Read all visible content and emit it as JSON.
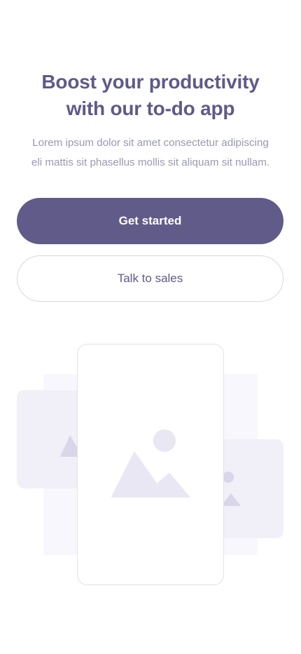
{
  "hero": {
    "title_lines": [
      "Boost your productivity",
      "with our to-do app"
    ],
    "subtitle_lines": [
      "Lorem ipsum dolor sit amet consectetur adipiscing",
      "eli mattis sit phasellus mollis sit aliquam sit nullam."
    ]
  },
  "actions": {
    "primary_label": "Get started",
    "secondary_label": "Talk to sales"
  },
  "illustration": {
    "icon": "image-placeholder-icon",
    "colors": {
      "panel": "#f1f0f8",
      "panel_light": "#f8f7fd",
      "glyph": "#d8d6e8",
      "glyph_center": "#e9e7f4",
      "card_border": "#e2e1ea"
    }
  },
  "theme": {
    "primary": "#615b89",
    "heading": "#5f5a88",
    "muted": "#9a98b2"
  }
}
